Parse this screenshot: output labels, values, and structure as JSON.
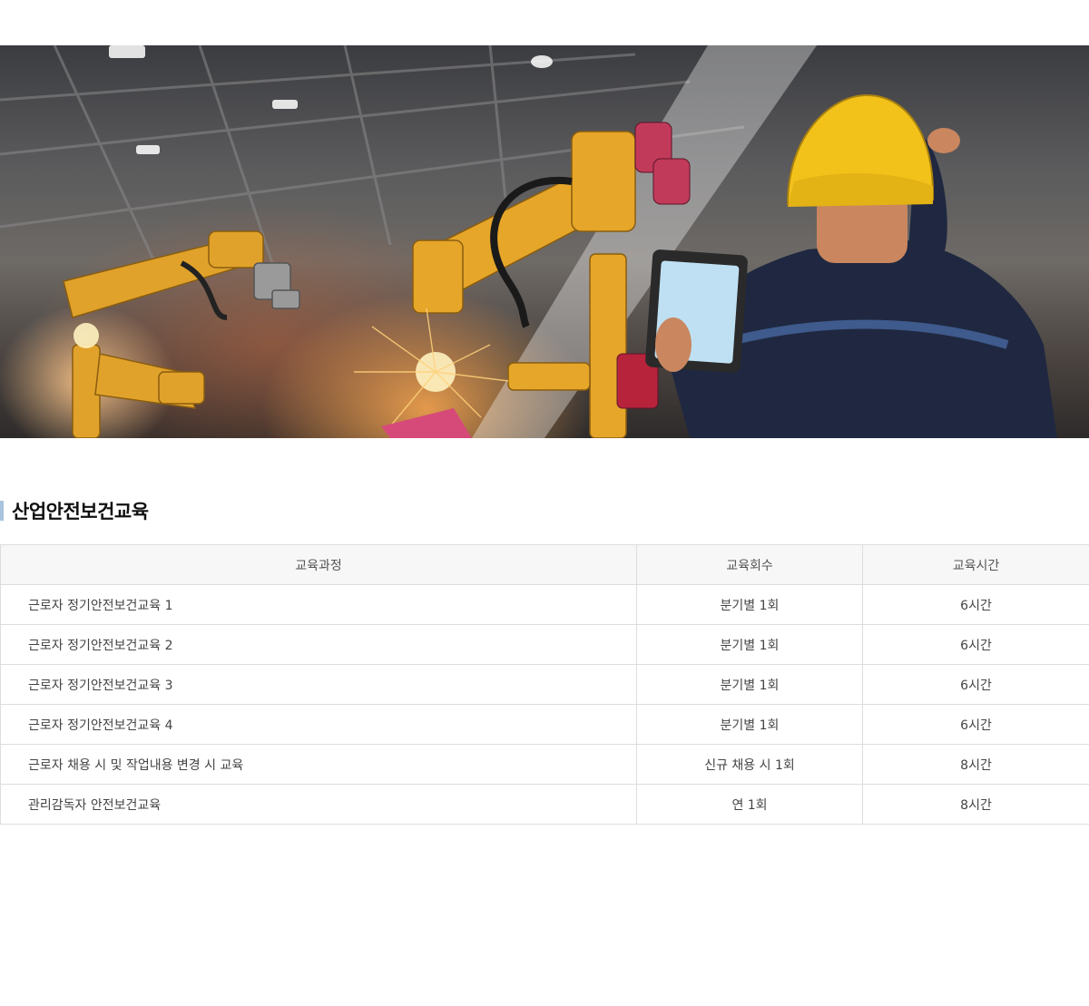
{
  "section": {
    "title": "산업안전보건교육"
  },
  "table": {
    "headers": {
      "course": "교육과정",
      "count": "교육회수",
      "hours": "교육시간"
    },
    "rows": [
      {
        "course": "근로자 정기안전보건교육 1",
        "count": "분기별 1회",
        "hours": "6시간"
      },
      {
        "course": "근로자 정기안전보건교육 2",
        "count": "분기별 1회",
        "hours": "6시간"
      },
      {
        "course": "근로자 정기안전보건교육 3",
        "count": "분기별 1회",
        "hours": "6시간"
      },
      {
        "course": "근로자 정기안전보건교육 4",
        "count": "분기별 1회",
        "hours": "6시간"
      },
      {
        "course": "근로자 채용 시 및 작업내용 변경 시 교육",
        "count": "신규 채용 시 1회",
        "hours": "8시간"
      },
      {
        "course": "관리감독자 안전보건교육",
        "count": "연 1회",
        "hours": "8시간"
      }
    ]
  },
  "colors": {
    "title_accent": "#a8c3dc",
    "header_bg": "#f7f7f7",
    "border": "#dddddd"
  }
}
